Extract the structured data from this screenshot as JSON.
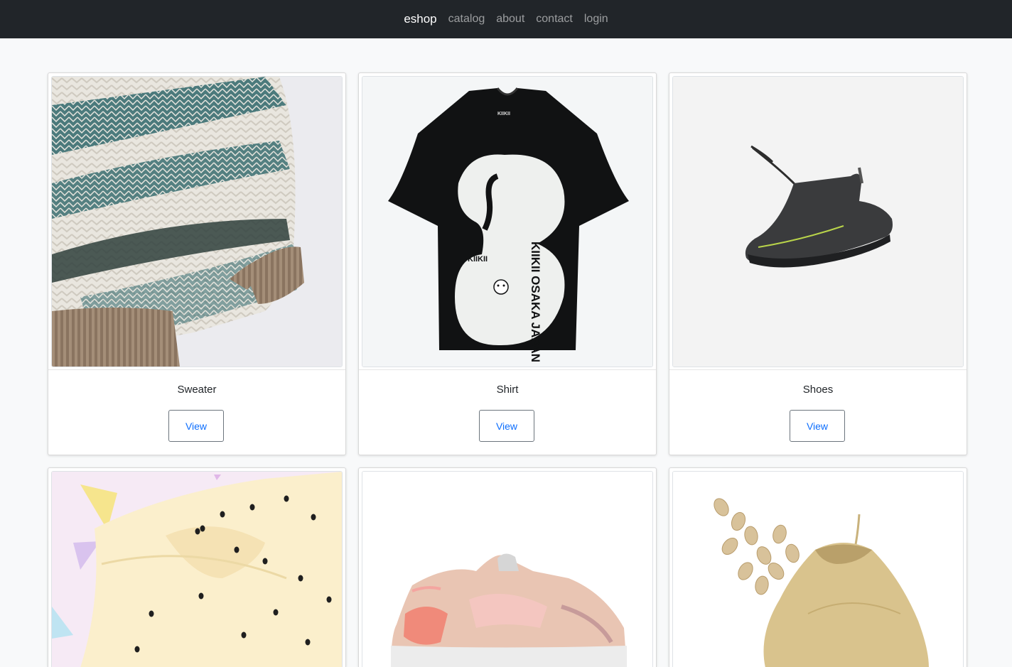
{
  "nav": {
    "brand": "eshop",
    "links": [
      "catalog",
      "about",
      "contact",
      "login"
    ]
  },
  "products": [
    {
      "name": "Sweater",
      "button": "View"
    },
    {
      "name": "Shirt",
      "button": "View"
    },
    {
      "name": "Shoes",
      "button": "View"
    }
  ],
  "shirt_print": {
    "numeral": "3",
    "brand": "KIIKII",
    "text": "KIIKII OSAKA JAPAN"
  },
  "colors": {
    "navbar": "#212529",
    "background": "#f8f9fa",
    "link": "#0d6efd"
  }
}
